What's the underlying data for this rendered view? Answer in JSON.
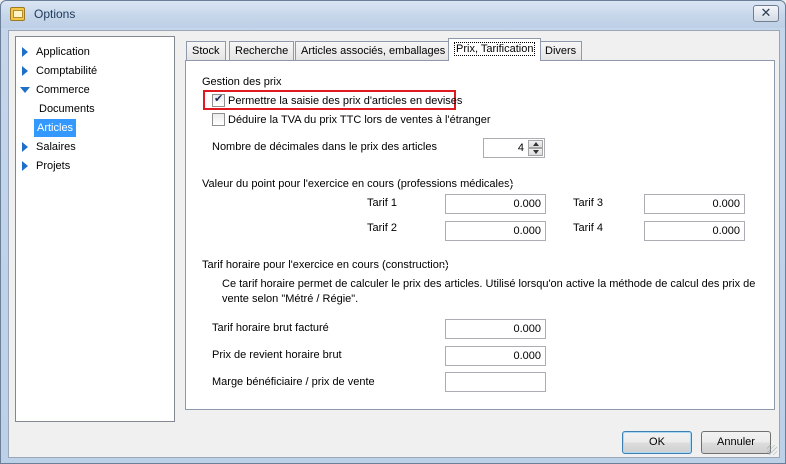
{
  "window": {
    "title": "Options",
    "close_glyph": "✕"
  },
  "sidebar": {
    "items": [
      {
        "label": "Application",
        "icon": "expand-arrow-icon"
      },
      {
        "label": "Comptabilité",
        "icon": "expand-arrow-icon"
      },
      {
        "label": "Commerce",
        "icon": "collapse-arrow-icon"
      },
      {
        "label": "Documents"
      },
      {
        "label": "Articles",
        "selected": true
      },
      {
        "label": "Salaires",
        "icon": "expand-arrow-icon"
      },
      {
        "label": "Projets",
        "icon": "expand-arrow-icon"
      }
    ]
  },
  "tabs": [
    {
      "label": "Stock"
    },
    {
      "label": "Recherche"
    },
    {
      "label": "Articles associés, emballages"
    },
    {
      "label": "Prix, Tarification",
      "active": true
    },
    {
      "label": "Divers"
    }
  ],
  "price_group": {
    "title": "Gestion des prix",
    "foreign_currency_checkbox": {
      "label": "Permettre la saisie des prix d'articles en devises",
      "checked": true
    },
    "vat_checkbox": {
      "label": "Déduire la TVA du prix TTC lors de ventes à l'étranger",
      "checked": false
    },
    "decimals_label": "Nombre de décimales dans le prix des articles",
    "decimals_value": "4"
  },
  "point_group": {
    "title": "Valeur du point pour l'exercice en cours (professions médicales)",
    "tarif1_label": "Tarif 1",
    "tarif1_value": "0.000",
    "tarif2_label": "Tarif 2",
    "tarif2_value": "0.000",
    "tarif3_label": "Tarif 3",
    "tarif3_value": "0.000",
    "tarif4_label": "Tarif 4",
    "tarif4_value": "0.000"
  },
  "hourly_group": {
    "title": "Tarif horaire pour l'exercice en cours (construction)",
    "description_line1": "Ce tarif horaire permet de calculer le prix des articles. Utilisé lorsqu'on active la méthode de calcul des prix de",
    "description_line2": "vente selon \"Métré / Régie\".",
    "gross_rate_label": "Tarif horaire brut facturé",
    "gross_rate_value": "0.000",
    "cost_price_label": "Prix de revient horaire brut",
    "cost_price_value": "0.000",
    "margin_label": "Marge bénéficiaire / prix de vente",
    "margin_value": ""
  },
  "buttons": {
    "ok": "OK",
    "cancel": "Annuler"
  },
  "colors": {
    "highlight": "#e01a22",
    "selection": "#3399ff",
    "tree_arrow": "#1e6fc7"
  }
}
